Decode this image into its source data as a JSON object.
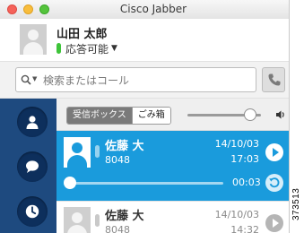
{
  "window": {
    "title": "Cisco Jabber"
  },
  "profile": {
    "name": "山田 太郎",
    "status": "応答可能",
    "status_color": "#3ec43a"
  },
  "search": {
    "placeholder": "検索またはコール"
  },
  "nav": {
    "items": [
      "contacts-icon",
      "chat-icon",
      "history-icon"
    ],
    "accent": "#1e4a7f"
  },
  "voicemail": {
    "tabs": {
      "inbox": "受信ボックス",
      "trash": "ごみ箱"
    },
    "volume_level": 0.85,
    "selected_color": "#1a9bdc",
    "messages": [
      {
        "name": "佐藤 大",
        "number": "8048",
        "date": "14/10/03",
        "time": "17:03",
        "selected": true,
        "playback_time": "00:03",
        "playback_progress": 0.0
      },
      {
        "name": "佐藤 大",
        "number": "8048",
        "date": "14/10/03",
        "time": "14:32",
        "selected": false
      }
    ]
  },
  "figure_id": "373513"
}
